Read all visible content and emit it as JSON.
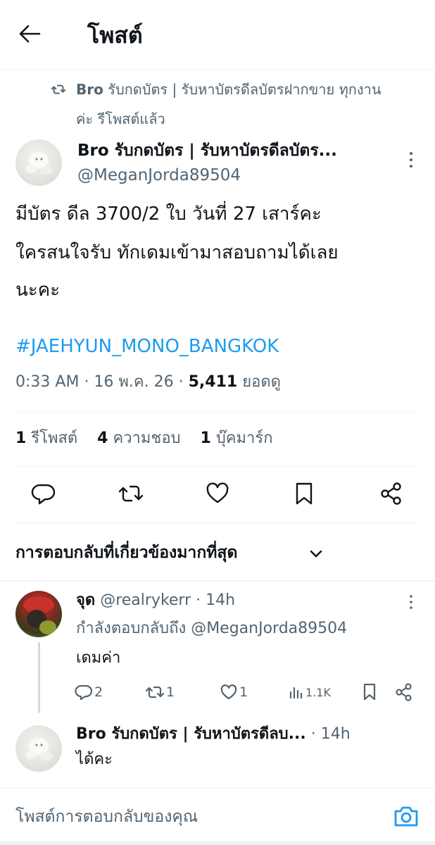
{
  "header": {
    "title": "โพสต์"
  },
  "repost_note": {
    "line1": "Bro รับกดบัตร | รับหาบัตรดีลบัตรฝากขาย ทุกงาน",
    "line2": "ค่ะ รีโพสต์แล้ว",
    "name_bold": "Bro"
  },
  "post": {
    "author_name": "Bro รับกดบัตร | รับหาบัตรดีลบัตร...",
    "author_handle": "@MeganJorda89504",
    "text_line1": "มีบัตร ดีล 3700/2 ใบ วันที่ 27 เสาร์คะ",
    "text_line2": "ใครสนใจรับ ทักเดมเข้ามาสอบถามได้เลย",
    "text_line3": "นะคะ",
    "hashtag": "#JAEHYUN_MONO_BANGKOK",
    "time": "0:33 AM",
    "date": "16 พ.ค. 26",
    "views_count": "5,411",
    "views_label": "ยอดดู",
    "repost_count": "1",
    "repost_label": "รีโพสต์",
    "like_count": "4",
    "like_label": "ความชอบ",
    "bookmark_count": "1",
    "bookmark_label": "บุ๊คมาร์ก"
  },
  "replies_sort": {
    "label": "การตอบกลับที่เกี่ยวข้องมากที่สุด"
  },
  "replies": [
    {
      "author_name": "จุด",
      "author_handle": "@realrykerr",
      "time": "· 14h",
      "replying_to_prefix": "กำลังตอบกลับถึง",
      "replying_to_handle": "@MeganJorda89504",
      "text": "เดมค่า",
      "reply_count": "2",
      "repost_count": "1",
      "like_count": "1",
      "views": "1.1K"
    },
    {
      "author_name": "Bro รับกดบัตร | รับหาบัตรดีลบ...",
      "time": "· 14h",
      "text": "ได้คะ"
    }
  ],
  "composer": {
    "placeholder": "โพสต์การตอบกลับของคุณ"
  },
  "icons": {
    "back": "back-arrow-icon",
    "repost": "repost-icon",
    "more": "more-icon",
    "reply": "reply-icon",
    "like": "heart-icon",
    "bookmark": "bookmark-icon",
    "share": "share-icon",
    "views": "views-icon",
    "chevron": "chevron-down-icon",
    "camera": "camera-icon"
  },
  "colors": {
    "accent": "#1d9bf0",
    "text": "#0f1419",
    "secondary": "#536471",
    "divider": "#eff3f4"
  }
}
